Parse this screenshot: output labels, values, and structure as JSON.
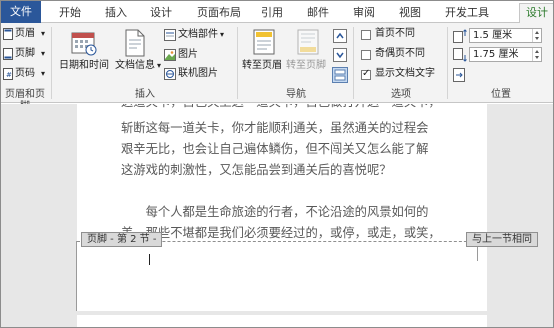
{
  "tabs": [
    {
      "label": "文件"
    },
    {
      "label": "开始"
    },
    {
      "label": "插入"
    },
    {
      "label": "设计"
    },
    {
      "label": "页面布局"
    },
    {
      "label": "引用"
    },
    {
      "label": "邮件"
    },
    {
      "label": "审阅"
    },
    {
      "label": "视图"
    },
    {
      "label": "开发工具"
    },
    {
      "label": "设计"
    }
  ],
  "ribbon": {
    "header_footer_group": {
      "label": "页眉和页脚",
      "header": "页眉",
      "footer": "页脚",
      "page_number": "页码"
    },
    "insert_group": {
      "label": "插入",
      "date_time": "日期和时间",
      "doc_info": "文档信息",
      "doc_parts": "文档部件",
      "picture": "图片",
      "online_picture": "联机图片"
    },
    "nav_group": {
      "label": "导航",
      "goto_header": "转至页眉",
      "goto_footer": "转至页脚"
    },
    "options_group": {
      "label": "选项",
      "first_page": {
        "label": "首页不同",
        "checked": false
      },
      "odd_even": {
        "label": "奇偶页不同",
        "checked": false
      },
      "show_text": {
        "label": "显示文档文字",
        "checked": true
      }
    },
    "position_group": {
      "label": "位置",
      "header_pos": "1.5 厘米",
      "footer_pos": "1.75 厘米"
    }
  },
  "document": {
    "lines": [
      "这道关卡，自己关上这一道关卡，自己做打开这一道关卡，",
      "斩断这每一道关卡，你才能顺利通关，虽然通关的过程会",
      "艰辛无比，也会让自己遍体鳞伤，但不闯关又怎么能了解",
      "这游戏的刺激性，又怎能品尝到通关后的喜悦呢？",
      "　　每个人都是生命旅途的行者，不论沿途的风景如何的",
      "美，那些不堪都是我们必须要经过的，或停，或走，或笑，"
    ],
    "footer_tag": "页脚 - 第 2 节 -",
    "same_as_previous": "与上一节相同"
  },
  "colors": {
    "file_tab": "#2b579a",
    "active_tab_text": "#2b7a2b",
    "ribbon_bg": "#f3f3f3",
    "doc_bg": "#e7e7e7"
  }
}
